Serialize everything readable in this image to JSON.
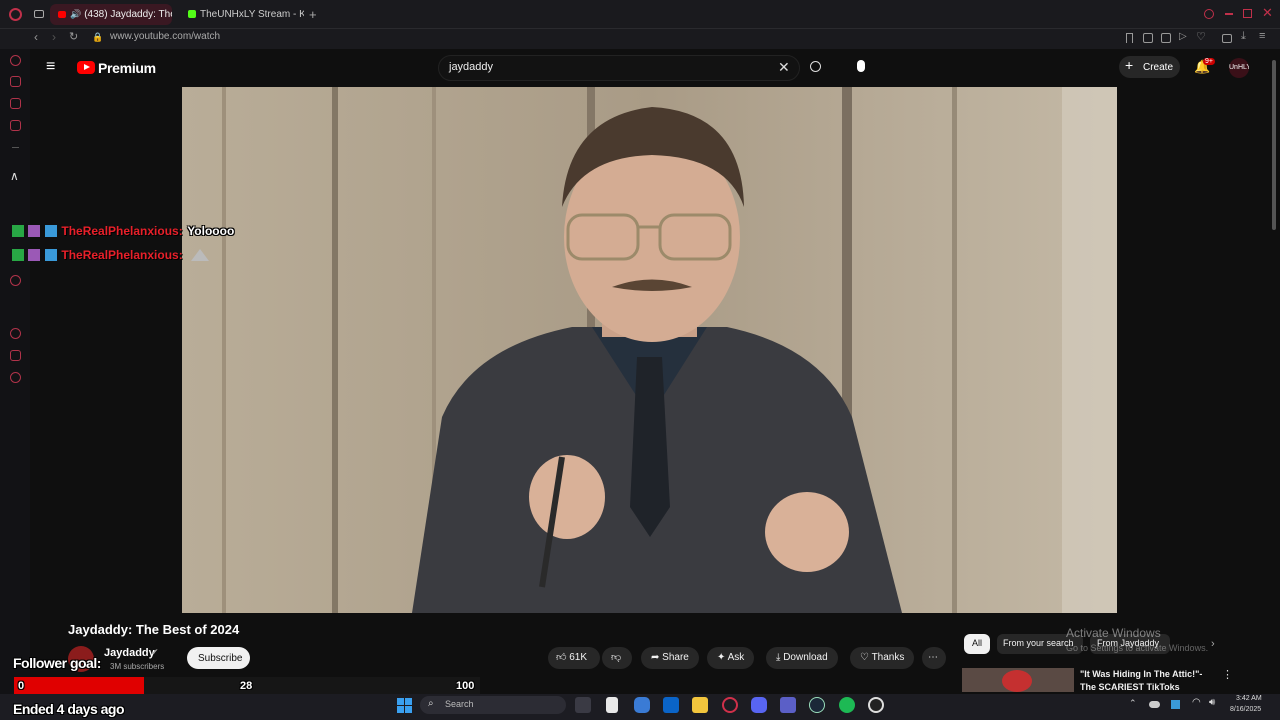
{
  "browser": {
    "tabs": [
      {
        "label": "(438) Jaydaddy: The I"
      },
      {
        "label": "TheUNHxLY Stream - Kic"
      }
    ],
    "url": "www.youtube.com/watch"
  },
  "youtube": {
    "logo_text": "Premium",
    "search_value": "jaydaddy",
    "create_label": "Create",
    "notification_badge": "9+",
    "avatar_text": "UnHLY"
  },
  "overlay": {
    "chat": [
      {
        "user": "TheRealPhelanxious:",
        "message": "Yoloooo"
      },
      {
        "user": "TheRealPhelanxious:",
        "message": ""
      }
    ],
    "follower_goal_label": "Follower goal:",
    "goal_current": "0",
    "goal_mid": "28",
    "goal_max": "100",
    "goal_progress": 0.0,
    "ended_text": "Ended 4 days ago"
  },
  "video": {
    "title": "Jaydaddy: The Best of 2024",
    "channel": "Jaydaddy",
    "subscribers": "3M subscribers",
    "subscribe_label": "Subscribe",
    "likes": "61K",
    "share_label": "Share",
    "ask_label": "Ask",
    "download_label": "Download",
    "thanks_label": "Thanks"
  },
  "related": {
    "chips": [
      "All",
      "From your search",
      "From Jaydaddy"
    ],
    "first_title_line1": "\"It Was Hiding In The Attic!\"-",
    "first_title_line2": "The SCARIEST TikToks"
  },
  "windows": {
    "activate_title": "Activate Windows",
    "activate_sub": "Go to Settings to activate Windows.",
    "taskbar_search": "Search",
    "time": "3:42 AM",
    "date": "8/16/2025"
  },
  "colors": {
    "accent_red": "#ff0000",
    "chat_name_red": "#e8202a",
    "tab_active": "#3a1822"
  }
}
